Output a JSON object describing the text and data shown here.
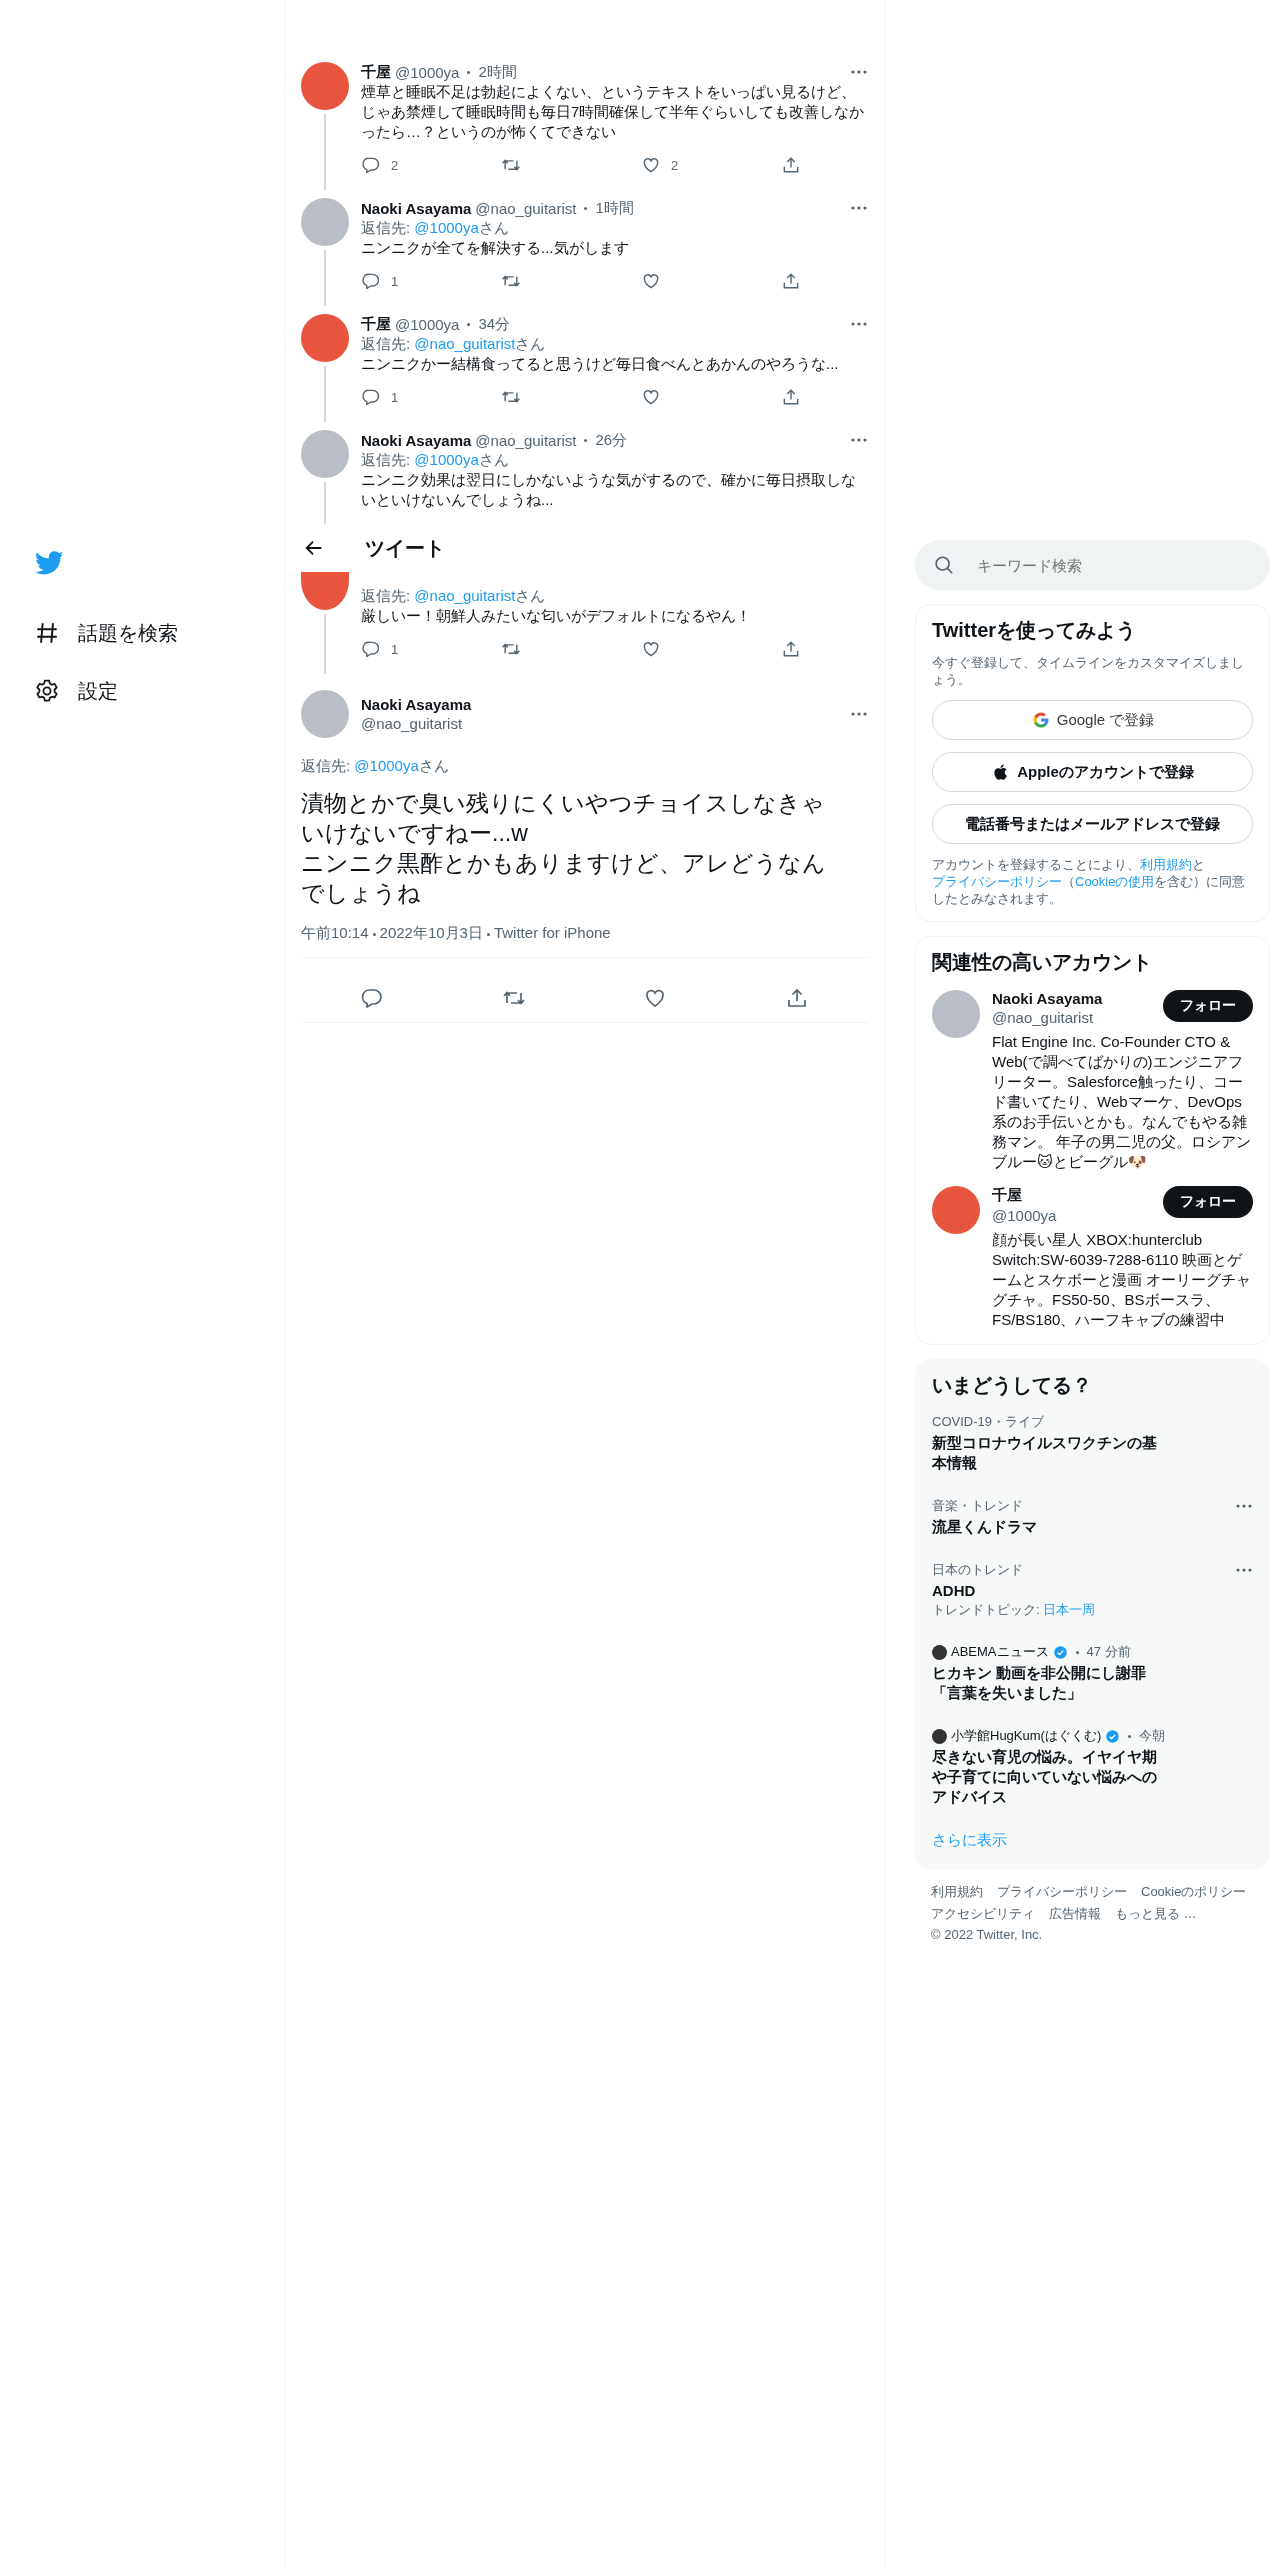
{
  "nav": {
    "items": [
      {
        "kind": "explore",
        "label": "話題を検索"
      },
      {
        "kind": "settings",
        "label": "設定"
      }
    ]
  },
  "header": {
    "title": "ツイート"
  },
  "thread": [
    {
      "author": {
        "name": "千屋",
        "handle": "@1000ya",
        "time": "2時間",
        "color": "#e8553f"
      },
      "text": "煙草と睡眠不足は勃起によくない、というテキストをいっぱい見るけど、じゃあ禁煙して睡眠時間も毎日7時間確保して半年ぐらいしても改善しなかったら…？というのが怖くてできない",
      "actions": {
        "reply": "2",
        "like": "2"
      }
    },
    {
      "author": {
        "name": "Naoki Asayama",
        "handle": "@nao_guitarist",
        "time": "1時間",
        "color": "#b9bec6"
      },
      "reply_to": {
        "label": "返信先:",
        "handle": "@1000ya",
        "suffix": "さん"
      },
      "text": "ニンニクが全てを解決する...気がします",
      "actions": {
        "reply": "1"
      }
    },
    {
      "author": {
        "name": "千屋",
        "handle": "@1000ya",
        "time": "34分",
        "color": "#e8553f"
      },
      "reply_to": {
        "label": "返信先:",
        "handle": "@nao_guitarist",
        "suffix": "さん"
      },
      "text": "ニンニクかー結構食ってると思うけど毎日食べんとあかんのやろうな...",
      "actions": {
        "reply": "1"
      }
    },
    {
      "author": {
        "name": "Naoki Asayama",
        "handle": "@nao_guitarist",
        "time": "26分",
        "color": "#b9bec6"
      },
      "reply_to": {
        "label": "返信先:",
        "handle": "@1000ya",
        "suffix": "さん"
      },
      "text": "ニンニク効果は翌日にしかないような気がするので、確かに毎日摂取しないといけないんでしょうね..."
    },
    {
      "color": "#e8553f",
      "reply_to": {
        "label": "返信先:",
        "handle": "@nao_guitarist",
        "suffix": "さん"
      },
      "text": "厳しいー！朝鮮人みたいな匂いがデフォルトになるやん！",
      "actions": {
        "reply": "1"
      }
    }
  ],
  "main_tweet": {
    "name": "Naoki Asayama",
    "handle": "@nao_guitarist",
    "color": "#b9bec6",
    "reply_to": {
      "label": "返信先:",
      "handle": "@1000ya",
      "suffix": "さん"
    },
    "text": "漬物とかで臭い残りにくいやつチョイスしなきゃいけないですねー...w\nニンニク黒酢とかもありますけど、アレどうなんでしょうね",
    "meta": [
      "午前10:14",
      "2022年10月3日",
      "Twitter for iPhone"
    ]
  },
  "search": {
    "placeholder": "キーワード検索"
  },
  "signup": {
    "title": "Twitterを使ってみよう",
    "subtitle": "今すぐ登録して、タイムラインをカスタマイズしましょう。",
    "buttons": [
      {
        "kind": "google",
        "label": "Google で登録"
      },
      {
        "kind": "apple",
        "label": "Appleのアカウントで登録"
      },
      {
        "kind": "plain",
        "label": "電話番号またはメールアドレスで登録"
      }
    ],
    "notice": [
      {
        "text": "アカウントを登録することにより、",
        "link": false
      },
      {
        "text": "利用規約",
        "link": true
      },
      {
        "text": "と",
        "link": false
      },
      {
        "text": "プライバシーポリシー",
        "link": true
      },
      {
        "text": "（",
        "link": false
      },
      {
        "text": "Cookieの使用",
        "link": true
      },
      {
        "text": "を含む）に同意したとみなされます。",
        "link": false
      }
    ]
  },
  "accounts": {
    "title": "関連性の高いアカウント",
    "items": [
      {
        "name": "Naoki Asayama",
        "handle": "@nao_guitarist",
        "color": "#b9bec6",
        "button": "フォロー",
        "bio": "Flat Engine Inc. Co-Founder CTO & Web(で調べてばかりの)エンジニアフリーター。Salesforce触ったり、コード書いてたり、Webマーケ、DevOps系のお手伝いとかも。なんでもやる雑務マン。 年子の男二児の父。ロシアンブルー🐱とビーグル🐶"
      },
      {
        "name": "千屋",
        "handle": "@1000ya",
        "color": "#e8553f",
        "button": "フォロー",
        "bio": "顔が長い星人 XBOX:hunterclub Switch:SW-6039-7288-6110 映画とゲームとスケボーと漫画 オーリーグチャグチャ。FS50-50、BSボースラ、FS/BS180、ハーフキャブの練習中"
      }
    ]
  },
  "trends": {
    "title": "いまどうしてる？",
    "items": [
      {
        "kind": "trend",
        "context": "COVID-19・ライブ",
        "title": "新型コロナウイルスワクチンの基本情報",
        "more": false
      },
      {
        "kind": "trend",
        "context": "音楽・トレンド",
        "title": "流星くんドラマ",
        "more": true
      },
      {
        "kind": "trend",
        "context": "日本のトレンド",
        "title": "ADHD",
        "more": true,
        "topic": {
          "label": "トレンドトピック:",
          "link": "日本一周"
        }
      },
      {
        "kind": "news",
        "source": "ABEMAニュース",
        "verified": true,
        "time": "47 分前",
        "title": "ヒカキン 動画を非公開にし謝罪「言葉を失いました」"
      },
      {
        "kind": "news",
        "source": "小学館HugKum(はぐくむ)",
        "verified": true,
        "time": "今朝",
        "title": "尽きない育児の悩み。イヤイヤ期や子育てに向いていない悩みへのアドバイス"
      }
    ],
    "more": "さらに表示"
  },
  "footer": {
    "links": [
      "利用規約",
      "プライバシーポリシー",
      "Cookieのポリシー",
      "アクセシビリティ",
      "広告情報",
      "もっと見る …"
    ],
    "copyright": "© 2022 Twitter, Inc."
  }
}
